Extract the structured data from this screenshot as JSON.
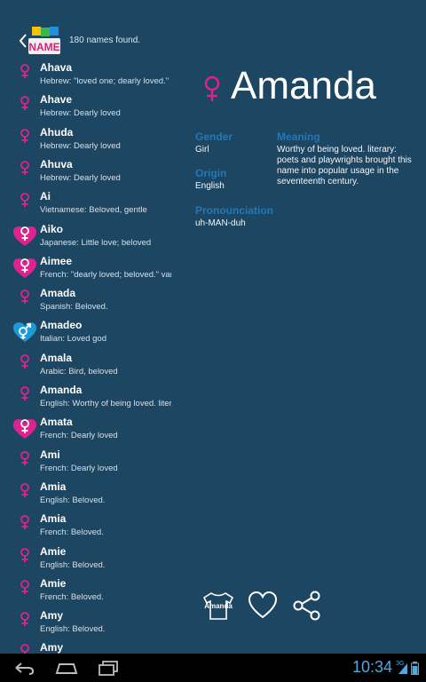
{
  "header": {
    "found_text": "180 names found.",
    "logo_text": "NAME"
  },
  "list": [
    {
      "name": "Ahava",
      "meaning": "Hebrew: \"loved one; dearly loved.\" v",
      "gender": "girl"
    },
    {
      "name": "Ahave",
      "meaning": "Hebrew: Dearly loved",
      "gender": "girl"
    },
    {
      "name": "Ahuda",
      "meaning": "Hebrew: Dearly loved",
      "gender": "girl"
    },
    {
      "name": "Ahuva",
      "meaning": "Hebrew: Dearly loved",
      "gender": "girl"
    },
    {
      "name": "Ai",
      "meaning": "Vietnamese: Beloved, gentle",
      "gender": "girl"
    },
    {
      "name": "Aiko",
      "meaning": "Japanese: Little love; beloved",
      "gender": "girl-fav"
    },
    {
      "name": "Aimee",
      "meaning": "French: \"dearly loved; beloved.\" vari",
      "gender": "girl-fav"
    },
    {
      "name": "Amada",
      "meaning": "Spanish: Beloved.",
      "gender": "girl"
    },
    {
      "name": "Amadeo",
      "meaning": "Italian: Loved god",
      "gender": "unisex-fav"
    },
    {
      "name": "Amala",
      "meaning": "Arabic: Bird, beloved",
      "gender": "girl"
    },
    {
      "name": "Amanda",
      "meaning": "English: Worthy of being loved. liter",
      "gender": "girl"
    },
    {
      "name": "Amata",
      "meaning": "French: Dearly loved",
      "gender": "girl-fav"
    },
    {
      "name": "Ami",
      "meaning": "French: Dearly loved",
      "gender": "girl"
    },
    {
      "name": "Amia",
      "meaning": "English: Beloved.",
      "gender": "girl"
    },
    {
      "name": "Amia",
      "meaning": "French: Beloved.",
      "gender": "girl"
    },
    {
      "name": "Amie",
      "meaning": "English: Beloved.",
      "gender": "girl"
    },
    {
      "name": "Amie",
      "meaning": "French: Beloved.",
      "gender": "girl"
    },
    {
      "name": "Amy",
      "meaning": "English: Beloved.",
      "gender": "girl"
    },
    {
      "name": "Amy",
      "meaning": "",
      "gender": "girl"
    }
  ],
  "detail": {
    "name": "Amanda",
    "gender_label": "Gender",
    "gender_value": "Girl",
    "origin_label": "Origin",
    "origin_value": "English",
    "pron_label": "Pronounciation",
    "pron_value": "uh-MAN-duh",
    "meaning_label": "Meaning",
    "meaning_value": "Worthy of being loved. literary: poets and playwrights brought this name into popular usage in the seventeenth century.",
    "shirt_text": "Amanda"
  },
  "status": {
    "time": "10:34",
    "signal": "3G"
  },
  "colors": {
    "background": "#1d4662",
    "pink": "#e0228f",
    "blue": "#1a9ad6",
    "label": "#2278b8"
  },
  "icons": {
    "girl": "female-symbol-icon",
    "girl-fav": "female-heart-icon",
    "unisex-fav": "unisex-heart-icon"
  }
}
